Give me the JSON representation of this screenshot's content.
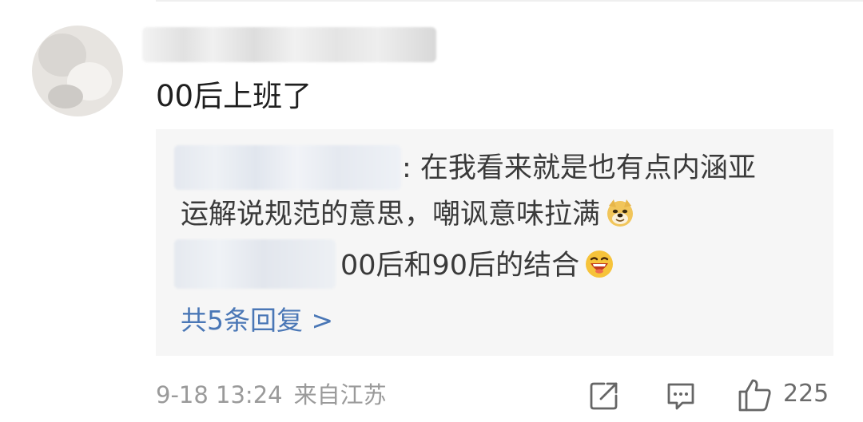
{
  "comment": {
    "text": "00后上班了"
  },
  "replies": [
    {
      "text_line1": ": 在我看来就是也有点内涵亚",
      "text_line2": "运解说规范的意思，嘲讽意味拉满",
      "emoji": "doge-emoji"
    },
    {
      "text": "00后和90后的结合",
      "emoji": "laughing-emoji"
    }
  ],
  "more_replies_label": "共5条回复 >",
  "footer": {
    "date": "9-18 13:24",
    "source": "来自江苏",
    "like_count": "225"
  },
  "icons": {
    "share": "share-icon",
    "comment": "comment-icon",
    "like": "thumbs-up-icon"
  },
  "colors": {
    "link": "#4a77b6",
    "reply_background": "#f6f6f6",
    "meta_text": "#9a9a9a"
  }
}
